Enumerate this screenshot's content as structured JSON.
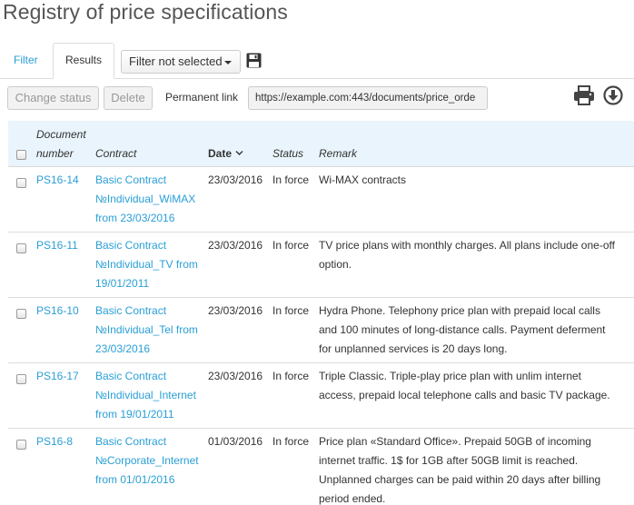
{
  "page": {
    "title": "Registry of price specifications"
  },
  "tabs": {
    "filter": "Filter",
    "results": "Results"
  },
  "filter_select": {
    "value": "Filter not selected"
  },
  "toolbar": {
    "change_status": "Change status",
    "delete": "Delete",
    "permanent_link_label": "Permanent link",
    "permanent_link_value": "https://example.com:443/documents/price_orde"
  },
  "table": {
    "headers": {
      "document_line1": "Document",
      "document_line2": "number",
      "contract": "Contract",
      "date": "Date",
      "status": "Status",
      "remark": "Remark"
    },
    "rows": [
      {
        "doc": "PS16-14",
        "contract": [
          "Basic Contract",
          "№Individual_WiMAX",
          "from 23/03/2016"
        ],
        "date": "23/03/2016",
        "status": "In force",
        "remark": [
          "Wi-MAX contracts"
        ]
      },
      {
        "doc": "PS16-11",
        "contract": [
          "Basic Contract",
          "№Individual_TV from",
          "19/01/2011"
        ],
        "date": "23/03/2016",
        "status": "In force",
        "remark": [
          "TV price plans with monthly charges. All plans include one-off",
          "option."
        ]
      },
      {
        "doc": "PS16-10",
        "contract": [
          "Basic Contract",
          "№Individual_Tel from",
          "23/03/2016"
        ],
        "date": "23/03/2016",
        "status": "In force",
        "remark": [
          "Hydra Phone. Telephony price plan with prepaid local calls",
          "and 100 minutes of long-distance calls. Payment deferment",
          "for unplanned services is 20 days long."
        ]
      },
      {
        "doc": "PS16-17",
        "contract": [
          "Basic Contract",
          "№Individual_Internet",
          "from 19/01/2011"
        ],
        "date": "23/03/2016",
        "status": "In force",
        "remark": [
          "Triple Classic. Triple-play price plan with unlim internet",
          "access, prepaid local telephone calls and basic TV package."
        ]
      },
      {
        "doc": "PS16-8",
        "contract": [
          "Basic Contract",
          "№Corporate_Internet",
          "from 01/01/2016"
        ],
        "date": "01/03/2016",
        "status": "In force",
        "remark": [
          "Price plan «Standard Office». Prepaid 50GB of incoming",
          "internet traffic. 1$ for 1GB after 50GB limit is reached.",
          "Unplanned charges can be paid within 20 days after billing",
          "period ended."
        ]
      }
    ]
  },
  "icons": {
    "save": "floppy-disk-icon",
    "print": "printer-icon",
    "download": "download-circle-icon",
    "sort": "chevron-down-icon"
  },
  "colors": {
    "link": "#2a9fd6",
    "header_bg": "#e9f4fc",
    "text": "#333333"
  }
}
